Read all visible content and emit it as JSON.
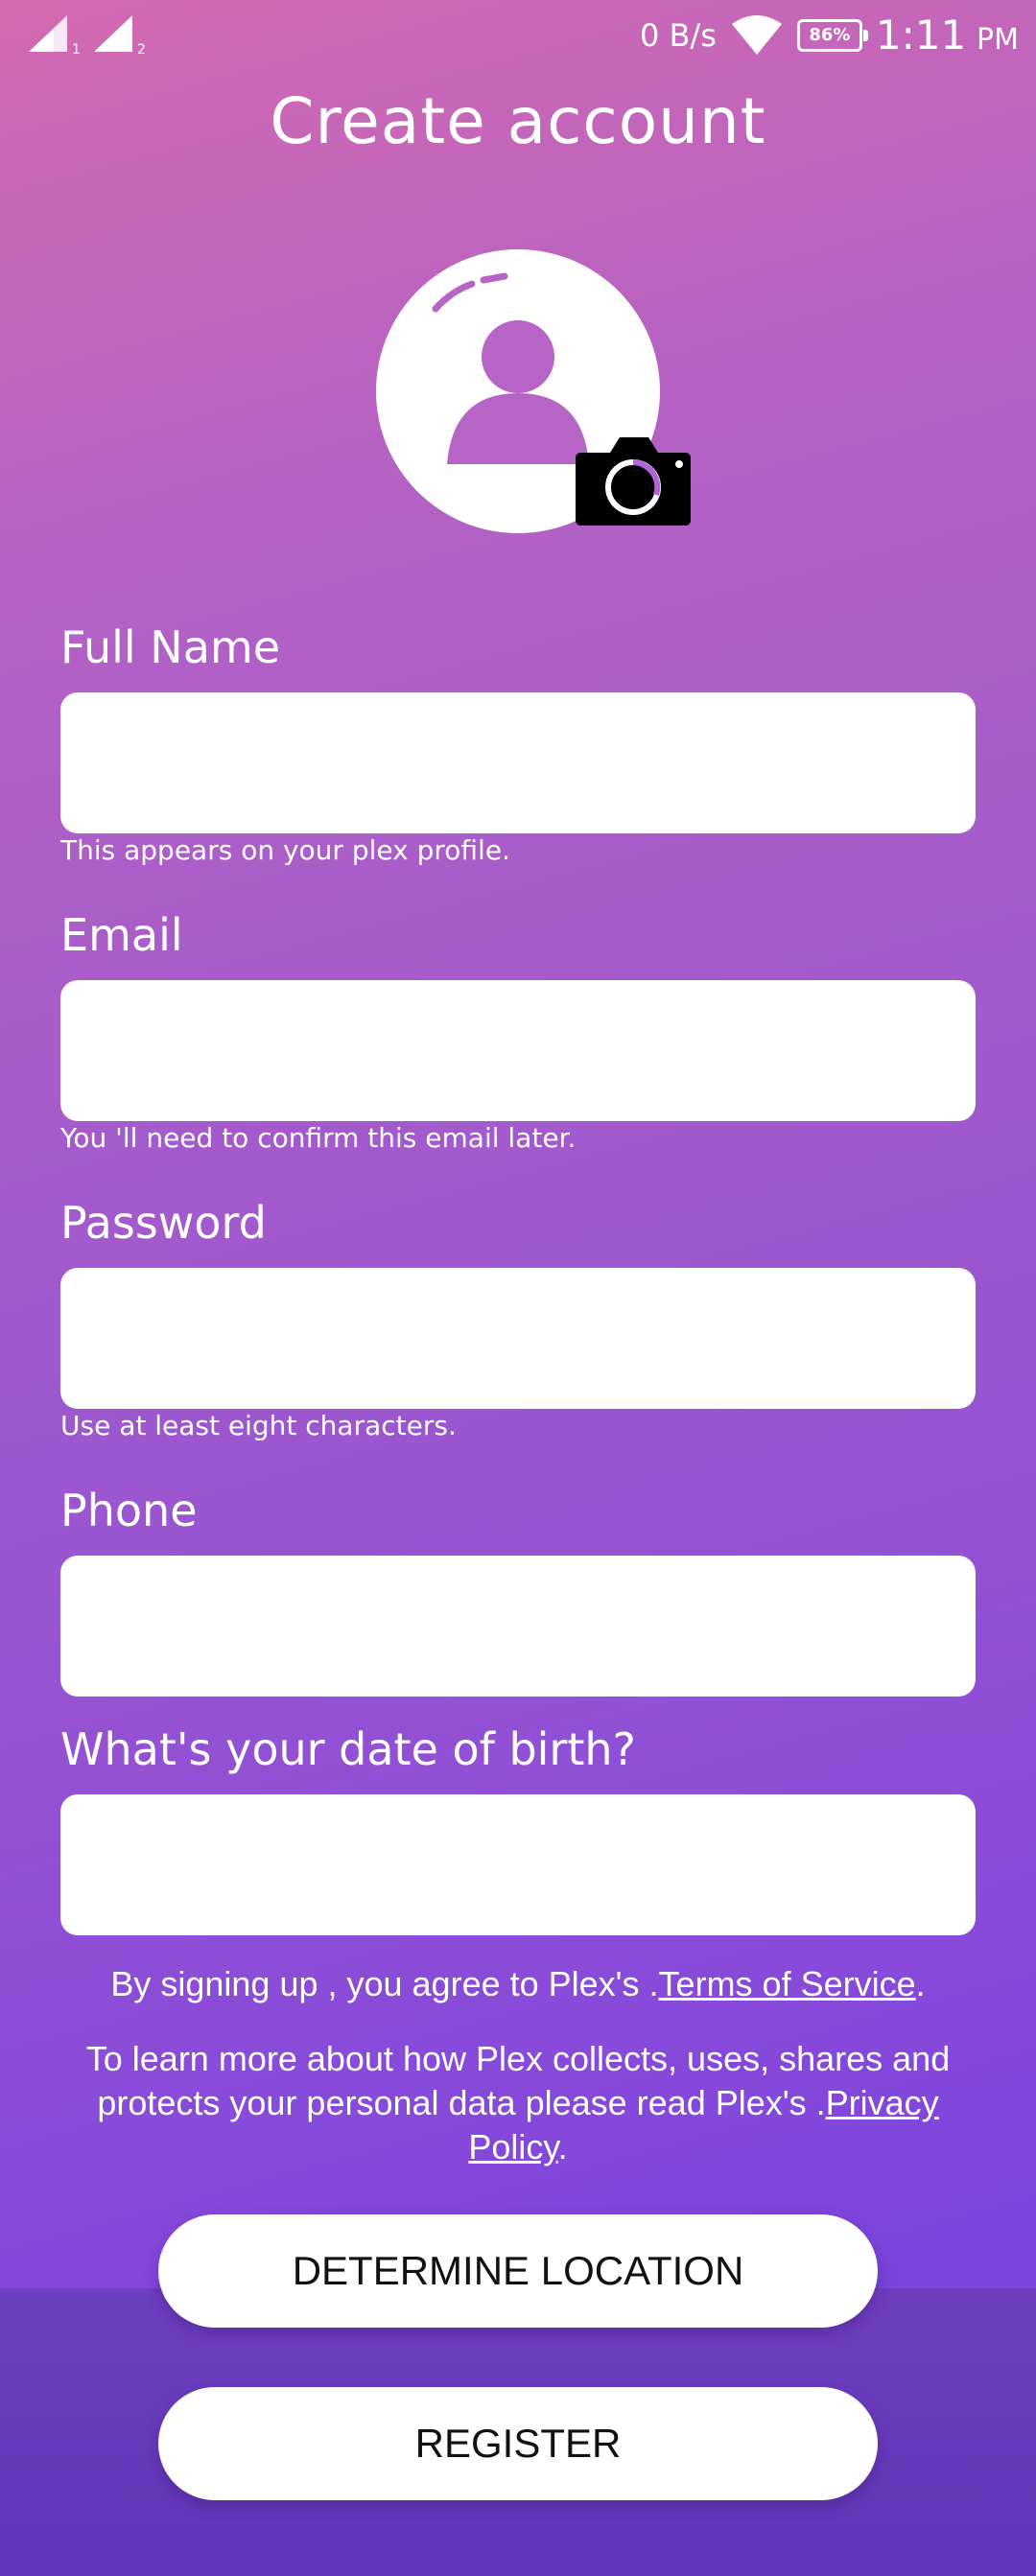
{
  "status_bar": {
    "sim1": "1",
    "sim2": "2",
    "speed": "0 B/s",
    "battery": "86%",
    "time": "1:11",
    "ampm": "PM"
  },
  "header": {
    "title": "Create account"
  },
  "avatar": {
    "icon": "person-icon",
    "camera_icon": "camera-icon"
  },
  "form": {
    "full_name": {
      "label": "Full Name",
      "value": "",
      "hint": "This appears on your plex profile."
    },
    "email": {
      "label": "Email",
      "value": "",
      "hint": "You 'll need to confirm this email later."
    },
    "password": {
      "label": "Password",
      "value": "",
      "hint": "Use at least eight characters."
    },
    "phone": {
      "label": "Phone",
      "value": ""
    },
    "dob": {
      "label": "What's your date of birth?",
      "value": ""
    }
  },
  "legal": {
    "terms_prefix": "By signing up , you agree to Plex's .",
    "terms_link": "Terms of Service",
    "terms_suffix": ".",
    "privacy_prefix": "To learn more about how Plex collects, uses, shares and protects your personal data please read Plex's .",
    "privacy_link": "Privacy Policy",
    "privacy_suffix": "."
  },
  "buttons": {
    "determine_location": "DETERMINE LOCATION",
    "register": "REGISTER"
  },
  "colors": {
    "gradient_top": "#d36ab0",
    "gradient_bottom": "#7a44dc",
    "bottom_band": "#6236b8",
    "camera_ring": "#b064d8"
  }
}
